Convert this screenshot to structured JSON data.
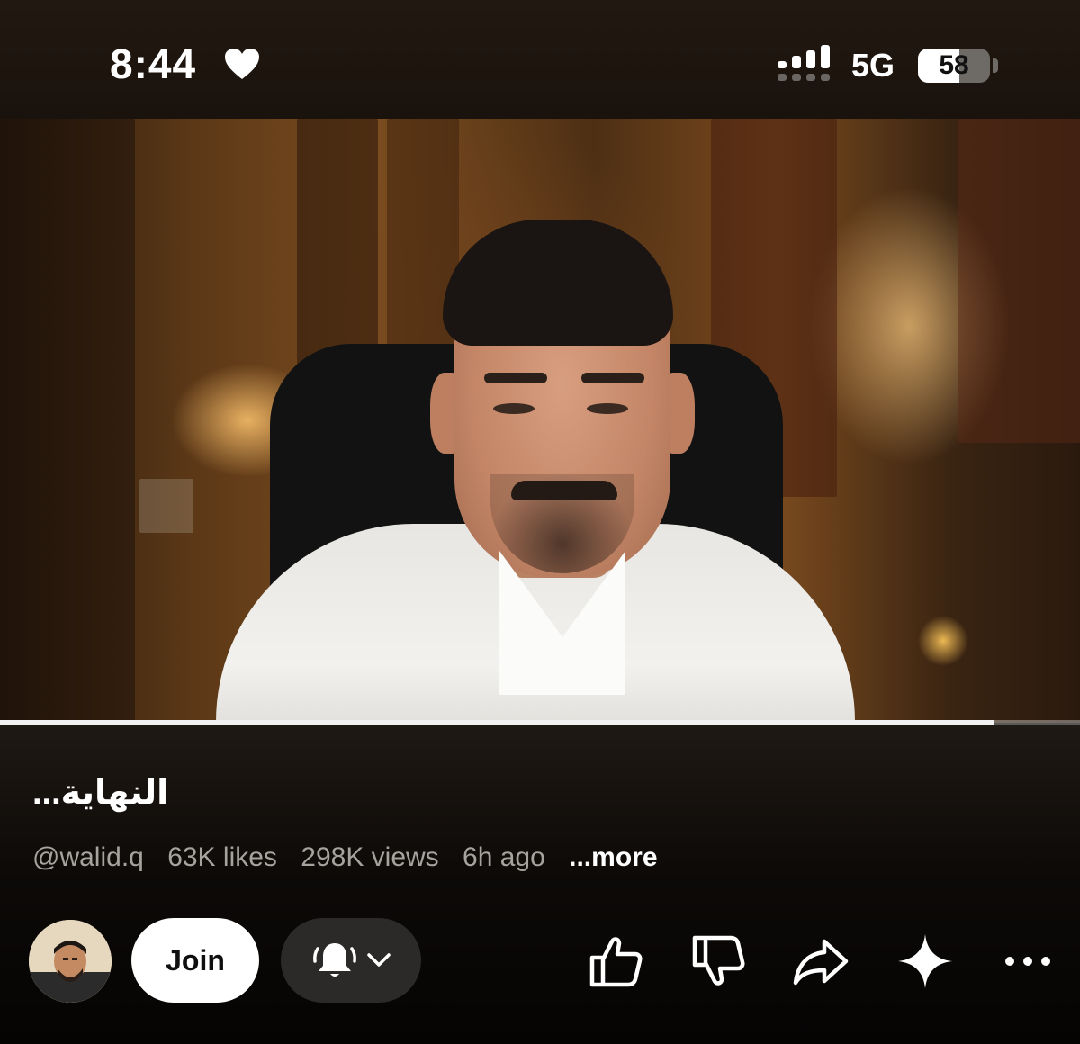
{
  "status_bar": {
    "time": "8:44",
    "network": "5G",
    "battery_percent": "58",
    "battery_level": 0.58,
    "icons": [
      "heart-icon",
      "signal-bars-icon"
    ]
  },
  "video": {
    "progress_fraction": 0.92
  },
  "details": {
    "title": "النهاية...",
    "channel_handle": "@walid.q",
    "likes": "63K likes",
    "views": "298K views",
    "posted": "6h ago",
    "more_label": "...more"
  },
  "actions": {
    "join_label": "Join",
    "icons": [
      "avatar",
      "bell-icon",
      "chevron-down-icon",
      "like-icon",
      "dislike-icon",
      "share-icon",
      "sparkle-icon",
      "more-options-icon"
    ]
  },
  "colors": {
    "background": "#000000",
    "meta_text": "#a6a29e",
    "join_bg": "#ffffff",
    "notify_bg": "#2b2a28"
  }
}
